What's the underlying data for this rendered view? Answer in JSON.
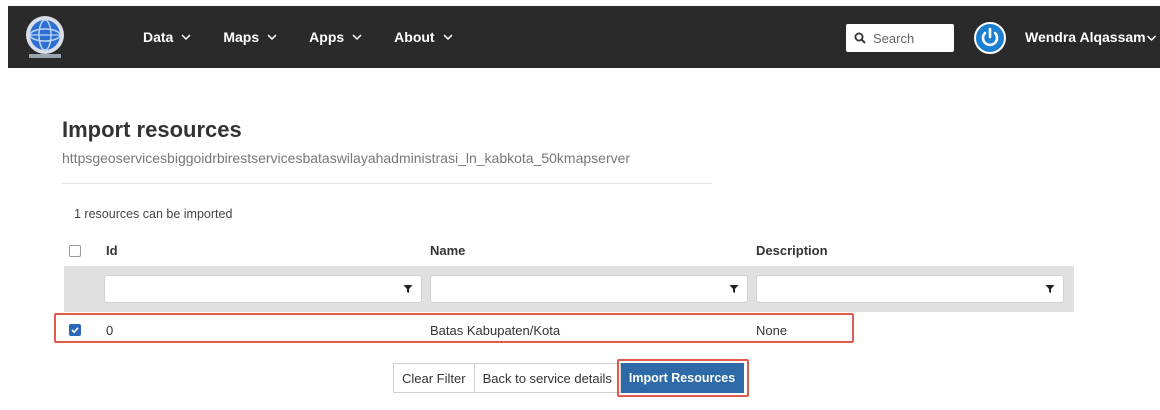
{
  "navbar": {
    "logo_icon": "globe-logo-icon",
    "menu": [
      {
        "label": "Data"
      },
      {
        "label": "Maps"
      },
      {
        "label": "Apps"
      },
      {
        "label": "About"
      }
    ],
    "search": {
      "placeholder": "Search"
    },
    "user": {
      "name": "Wendra Alqassam",
      "avatar_icon": "power-icon"
    }
  },
  "main": {
    "title": "Import resources",
    "service_url": "httpsgeoservicesbiggoidrbirestservicesbataswilayahadministrasi_ln_kabkota_50kmapserver",
    "import_count": "1 resources can be imported"
  },
  "table": {
    "columns": [
      {
        "label": "Id"
      },
      {
        "label": "Name"
      },
      {
        "label": "Description"
      }
    ],
    "filters": [
      {
        "value": "",
        "icon": "filter-icon"
      },
      {
        "value": "",
        "icon": "filter-icon"
      },
      {
        "value": "",
        "icon": "filter-icon"
      }
    ],
    "rows": [
      {
        "checked": true,
        "id": "0",
        "name": "Batas Kabupaten/Kota",
        "description": "None"
      }
    ]
  },
  "actions": {
    "clear_filter": "Clear Filter",
    "back": "Back to service details",
    "import": "Import Resources"
  },
  "colors": {
    "navbar_bg": "#2a2a2a",
    "primary": "#2f6aa8",
    "highlight": "#e05a4d",
    "avatar": "#1a7fd0"
  }
}
